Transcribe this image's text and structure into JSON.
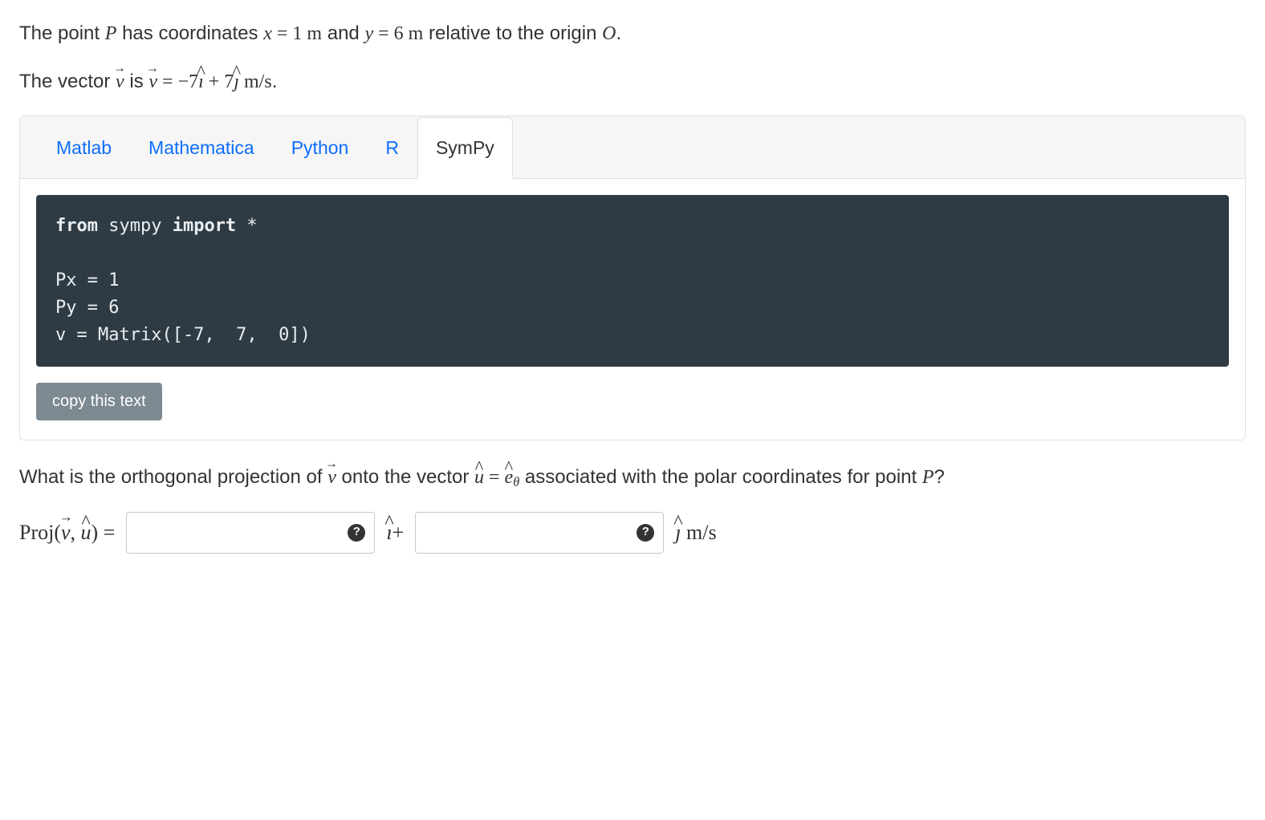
{
  "problem": {
    "line1_pre": "The point ",
    "var_P": "P",
    "line1_mid1": " has coordinates ",
    "var_x": "x",
    "eq_sym": " = ",
    "x_val": "1",
    "unit_m1": " m",
    "line1_mid2": " and ",
    "var_y": "y",
    "y_val": "6",
    "unit_m2": " m",
    "line1_post": " relative to the origin ",
    "var_O": "O",
    "period": ".",
    "line2_pre": "The vector ",
    "var_v": "v",
    "line2_mid": " is ",
    "v_expr_a": "−7",
    "v_expr_ihat": "ı",
    "v_expr_plus": " + 7",
    "v_expr_jhat": "ȷ",
    "unit_ms": " m/s",
    "question_pre": "What is the orthogonal projection of ",
    "question_mid1": " onto the vector ",
    "var_u": "u",
    "question_mid2": " = ",
    "var_e": "e",
    "sub_theta": "θ",
    "question_post": " associated with the polar coordinates for point ",
    "proj_label_a": "Proj(",
    "proj_label_b": ", ",
    "proj_label_c": ") = "
  },
  "tabs": [
    {
      "label": "Matlab",
      "active": false
    },
    {
      "label": "Mathematica",
      "active": false
    },
    {
      "label": "Python",
      "active": false
    },
    {
      "label": "R",
      "active": false
    },
    {
      "label": "SymPy",
      "active": true
    }
  ],
  "code": {
    "line1_kw1": "from",
    "line1_pkg": " sympy ",
    "line1_kw2": "import",
    "line1_star": " *",
    "line3": "Px = 1",
    "line4": "Py = 6",
    "line5": "v = Matrix([-7,  7,  0])"
  },
  "copy_button": "copy this text",
  "answer": {
    "ihat_plus": "ı",
    "plus": "+",
    "jhat": "ȷ",
    "unit": " m/s",
    "help": "?"
  },
  "inputs": {
    "i_value": "",
    "j_value": ""
  }
}
